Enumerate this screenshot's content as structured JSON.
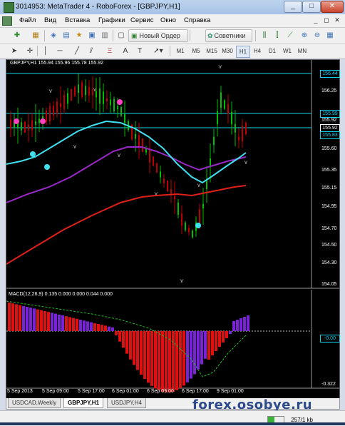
{
  "window": {
    "title": "3014953: MetaTrader 4 - RoboForex - [GBPJPY,H1]",
    "minimize": "_",
    "maximize": "□",
    "close": "✕"
  },
  "menu": {
    "items": [
      "Файл",
      "Вид",
      "Вставка",
      "Графики",
      "Сервис",
      "Окно",
      "Справка"
    ],
    "mdi_controls": [
      "_",
      "◻",
      "✕"
    ]
  },
  "toolbar": {
    "new_order": "Новый Ордер",
    "advisors": "Советники"
  },
  "timeframes": {
    "items": [
      "M1",
      "M5",
      "M15",
      "M30",
      "H1",
      "H4",
      "D1",
      "W1",
      "MN"
    ],
    "active": "H1"
  },
  "chart": {
    "symbol_info": "GBPJPY,H1  155.94 155.96 155.78 155.92",
    "macd_info": "MACD(12,26,9) 0.135 0.000 0.000 0.044 0.000",
    "price_labels": [
      "156.25",
      "155.92",
      "155.60",
      "155.35",
      "155.15",
      "154.95",
      "154.70",
      "154.50",
      "154.30",
      "154.05"
    ],
    "price_boxes": {
      "top": "156.44",
      "mid": "155.99",
      "bid": "155.92",
      "low": "155.83"
    },
    "macd_labels": {
      "level": "-0.00",
      "min": "-0.322"
    },
    "time_labels": [
      "5 Sep 2013",
      "5 Sep 09:00",
      "5 Sep 17:00",
      "6 Sep 01:00",
      "6 Sep 09:00",
      "6 Sep 17:00",
      "9 Sep 01:00"
    ],
    "colors": {
      "background": "#000000",
      "bull": "#00c000",
      "bear": "#c00000",
      "ma_fast": "#40e0f0",
      "ma_mid": "#9a28c8",
      "ma_slow": "#e0201a",
      "level_line": "#10d8f0",
      "macd_red": "#e01010",
      "macd_purple": "#7a22d8"
    }
  },
  "tabs": {
    "items": [
      "USDCAD,Weekly",
      "GBPJPY,H1",
      "USDJPY,H4"
    ],
    "active": "GBPJPY,H1"
  },
  "watermark": "forex.osobye.ru",
  "status": {
    "traffic": "257/1 kb"
  }
}
